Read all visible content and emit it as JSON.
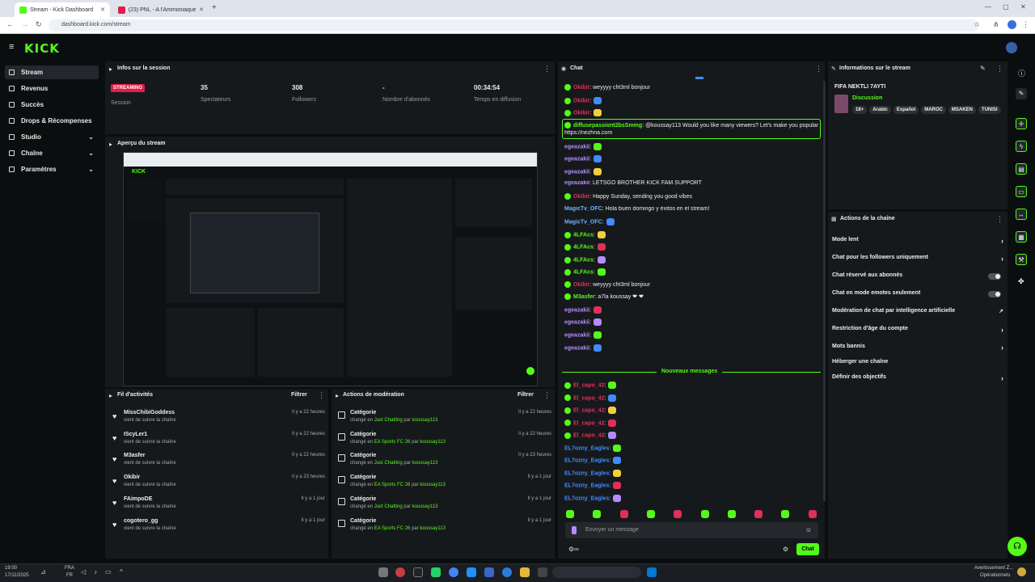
{
  "browser": {
    "tabs": [
      {
        "label": "Stream - Kick Dashboard",
        "active": true
      },
      {
        "label": "(23) PNL - A l'Ammoniaque [C...",
        "active": false
      }
    ],
    "url": "dashboard.kick.com/stream"
  },
  "brand": {
    "logo": "KICK",
    "accent": "#53fc18"
  },
  "sidebar": {
    "items": [
      {
        "label": "Stream",
        "icon": "broadcast-icon",
        "active": true,
        "expandable": false
      },
      {
        "label": "Revenus",
        "icon": "revenue-icon",
        "expandable": false
      },
      {
        "label": "Succès",
        "icon": "trophy-icon",
        "expandable": false
      },
      {
        "label": "Drops & Récompenses",
        "icon": "gift-icon",
        "expandable": false
      },
      {
        "label": "Studio",
        "icon": "studio-icon",
        "expandable": true
      },
      {
        "label": "Chaîne",
        "icon": "channel-icon",
        "expandable": true
      },
      {
        "label": "Paramètres",
        "icon": "gear-icon",
        "expandable": true
      }
    ]
  },
  "session": {
    "title": "Infos sur la session",
    "badge": "STREAMING",
    "badge_label": "Session",
    "stats": [
      {
        "value": "35",
        "label": "Spectateurs"
      },
      {
        "value": "308",
        "label": "Followers"
      },
      {
        "value": "-",
        "label": "Nombre d'abonnés"
      },
      {
        "value": "00:34:54",
        "label": "Temps en diffusion"
      }
    ]
  },
  "preview": {
    "title": "Aperçu du stream"
  },
  "activity": {
    "title": "Fil d'activités",
    "filter": "Filtrer",
    "items": [
      {
        "name": "MissChibiGoddess",
        "sub": "vient de suivre la chaîne",
        "time": "Il y a 22 heures"
      },
      {
        "name": "IScyLer1",
        "sub": "vient de suivre la chaîne",
        "time": "Il y a 22 heures"
      },
      {
        "name": "M3asfer",
        "sub": "vient de suivre la chaîne",
        "time": "Il y a 22 heures"
      },
      {
        "name": "Okibir",
        "sub": "vient de suivre la chaîne",
        "time": "Il y a 23 heures"
      },
      {
        "name": "FAimpoDE",
        "sub": "vient de suivre la chaîne",
        "time": "Il y a 1 jour"
      },
      {
        "name": "cogotero_gg",
        "sub": "vient de suivre la chaîne",
        "time": "Il y a 1 jour"
      }
    ]
  },
  "moderation": {
    "title": "Actions de modération",
    "filter": "Filtrer",
    "items": [
      {
        "cat": "Catégorie",
        "pre": "changé en",
        "value": "Just Chatting",
        "by": "par",
        "user": "koussay113",
        "time": "Il y a 22 heures"
      },
      {
        "cat": "Catégorie",
        "pre": "changé en",
        "value": "EA Sports FC 26",
        "by": "par",
        "user": "koussay113",
        "time": "Il y a 22 heures"
      },
      {
        "cat": "Catégorie",
        "pre": "changé en",
        "value": "Just Chatting",
        "by": "par",
        "user": "koussay113",
        "time": "Il y a 23 heures"
      },
      {
        "cat": "Catégorie",
        "pre": "changé en",
        "value": "EA Sports FC 26",
        "by": "par",
        "user": "koussay113",
        "time": "Il y a 1 jour"
      },
      {
        "cat": "Catégorie",
        "pre": "changé en",
        "value": "Just Chatting",
        "by": "par",
        "user": "koussay113",
        "time": "Il y a 1 jour"
      },
      {
        "cat": "Catégorie",
        "pre": "changé en",
        "value": "EA Sports FC 26",
        "by": "par",
        "user": "koussay113",
        "time": "Il y a 1 jour"
      }
    ]
  },
  "chat": {
    "title": "Chat",
    "messages": [
      {
        "user": "Okibir",
        "color": "#e0305a",
        "text": ": weyyyy cht3ml bonjour"
      },
      {
        "user": "Okibir",
        "color": "#e0305a",
        "text": ":"
      },
      {
        "user": "Okibir",
        "color": "#e0305a",
        "text": ":"
      },
      {
        "user": "diffusepassiont2bsSmmg",
        "color": "#53fc18",
        "text": ": @koussay113 Would you like many viewers? Let's make you popular —"
      },
      {
        "user": "",
        "color": "#53fc18",
        "text": "https://nezhna.com"
      },
      {
        "user": "egeazakii",
        "color": "#b48cff",
        "text": ":"
      },
      {
        "user": "egeazakii",
        "color": "#b48cff",
        "text": ":"
      },
      {
        "user": "egeazakii",
        "color": "#b48cff",
        "text": ":"
      },
      {
        "user": "egeazakii",
        "color": "#b48cff",
        "text": ": LETSGO BROTHER KICK FAM SUPPORT"
      },
      {
        "user": "Okibir",
        "color": "#e0305a",
        "text": ": Happy Sunday, sending you good vibes"
      },
      {
        "user": "MagicTv_OFC",
        "color": "#6fb2ff",
        "text": ": Hola buen domingo y éxitos en el stream!"
      },
      {
        "user": "MagicTv_OFC",
        "color": "#6fb2ff",
        "text": ":"
      },
      {
        "user": "4LFAcs",
        "color": "#53fc18",
        "text": ":"
      },
      {
        "user": "4LFAcs",
        "color": "#53fc18",
        "text": ":"
      },
      {
        "user": "4LFAcs",
        "color": "#53fc18",
        "text": ":"
      },
      {
        "user": "4LFAcs",
        "color": "#53fc18",
        "text": ":"
      },
      {
        "user": "Okibir",
        "color": "#e0305a",
        "text": ": weyyyy cht3ml bonjour"
      },
      {
        "user": "M3asfer",
        "color": "#53fc18",
        "text": ": a7la koussay ❤ ❤"
      },
      {
        "user": "egeazakii",
        "color": "#b48cff",
        "text": ":"
      },
      {
        "user": "egeazakii",
        "color": "#b48cff",
        "text": ":"
      },
      {
        "user": "egeazakii",
        "color": "#b48cff",
        "text": ":"
      },
      {
        "user": "egeazakii",
        "color": "#b48cff",
        "text": ":"
      }
    ],
    "divider": "Nouveaux messages",
    "new_messages": [
      {
        "user": "El_capo_42",
        "color": "#e0305a",
        "text": ":"
      },
      {
        "user": "El_capo_42",
        "color": "#e0305a",
        "text": ":"
      },
      {
        "user": "El_capo_42",
        "color": "#e0305a",
        "text": ":"
      },
      {
        "user": "El_capo_42",
        "color": "#e0305a",
        "text": ":"
      },
      {
        "user": "El_capo_42",
        "color": "#e0305a",
        "text": ":"
      },
      {
        "user": "EL7ozny_Eagles",
        "color": "#3f8cff",
        "text": ":"
      },
      {
        "user": "EL7ozny_Eagles",
        "color": "#3f8cff",
        "text": ":"
      },
      {
        "user": "EL7ozny_Eagles",
        "color": "#3f8cff",
        "text": ":"
      },
      {
        "user": "EL7ozny_Eagles",
        "color": "#3f8cff",
        "text": ":"
      },
      {
        "user": "EL7ozny_Eagles",
        "color": "#3f8cff",
        "text": ":"
      }
    ],
    "input_placeholder": "Envoyer un message",
    "send_label": "Chat"
  },
  "stream_info": {
    "title": "Informations sur le stream",
    "stream_title": "FIFA NEKTLI 7AYTI",
    "category": "Discussion",
    "tags": [
      "18+",
      "Arabic",
      "Español",
      "MAROC",
      "MSAKEN",
      "TUNISI"
    ]
  },
  "channel_actions": {
    "title": "Actions de la chaîne",
    "items": [
      {
        "label": "Mode lent",
        "control": "chevron"
      },
      {
        "label": "Chat pour les followers uniquement",
        "control": "chevron"
      },
      {
        "label": "Chat réservé aux abonnés",
        "control": "toggle"
      },
      {
        "label": "Chat en mode emotes seulement",
        "control": "toggle"
      },
      {
        "label": "Modération de chat par intelligence artificielle",
        "control": "external"
      },
      {
        "label": "Restriction d'âge du compte",
        "control": "chevron"
      },
      {
        "label": "Mots bannis",
        "control": "chevron"
      },
      {
        "label": "Héberger une chaîne",
        "control": "none"
      },
      {
        "label": "Définir des objectifs",
        "control": "chevron"
      }
    ]
  },
  "taskbar": {
    "time": "19:00",
    "date": "17/11/2025",
    "lang": "FRA",
    "lang2": "FR",
    "notice": "Avertissement Z...",
    "notice2": "Opérationnels"
  }
}
